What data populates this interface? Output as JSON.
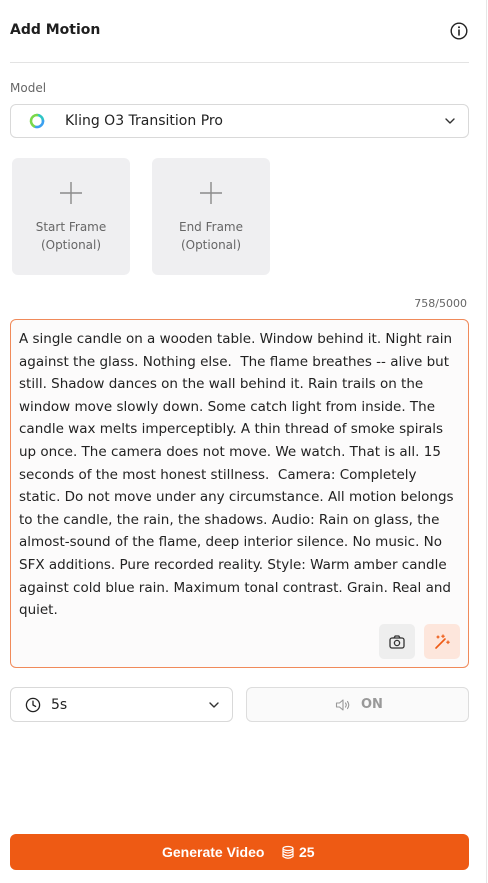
{
  "header": {
    "title": "Add Motion",
    "info_icon": "info-circle-icon"
  },
  "model": {
    "label": "Model",
    "selected": "Kling O3 Transition Pro",
    "logo_icon": "kling-logo-icon",
    "logo_colors": [
      "#2ec5c5",
      "#3aa0f0",
      "#7ad84a"
    ]
  },
  "frames": [
    {
      "line1": "Start Frame",
      "line2": "(Optional)"
    },
    {
      "line1": "End Frame",
      "line2": "(Optional)"
    }
  ],
  "prompt": {
    "counter": "758/5000",
    "text": "A single candle on a wooden table. Window behind it. Night rain against the glass. Nothing else.  The flame breathes -- alive but still. Shadow dances on the wall behind it. Rain trails on the window move slowly down. Some catch light from inside. The candle wax melts imperceptibly. A thin thread of smoke spirals up once. The camera does not move. We watch. That is all. 15 seconds of the most honest stillness.  Camera: Completely static. Do not move under any circumstance. All motion belongs to the candle, the rain, the shadows. Audio: Rain on glass, the almost-sound of the flame, deep interior silence. No music. No SFX additions. Pure recorded reality. Style: Warm amber candle against cold blue rain. Maximum tonal contrast. Grain. Real and quiet.",
    "camera_icon": "camera-icon",
    "enhance_icon": "magic-wand-icon"
  },
  "duration": {
    "value": "5s",
    "icon": "clock-icon"
  },
  "sound": {
    "label": "ON",
    "icon": "speaker-icon"
  },
  "generate": {
    "label": "Generate Video",
    "cost": "25",
    "icon": "coins-icon"
  },
  "colors": {
    "accent": "#ee5a14",
    "prompt_border": "#f08a5a",
    "frame_bg": "#efeff1"
  }
}
